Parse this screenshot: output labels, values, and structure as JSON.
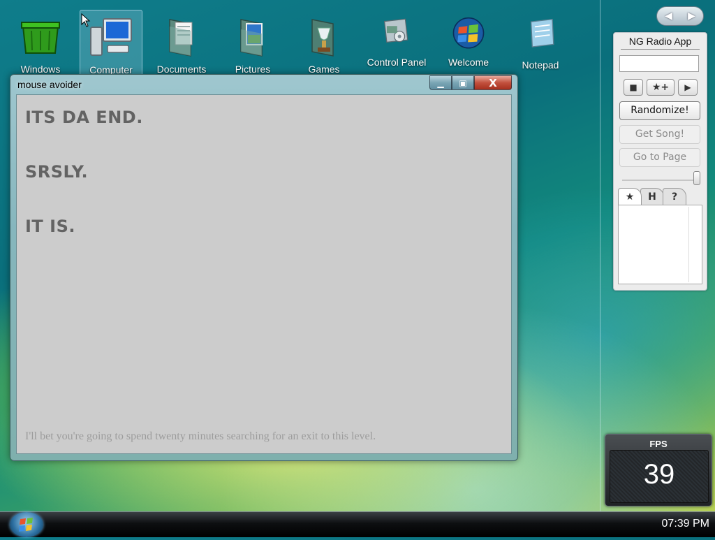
{
  "desktop": {
    "icons": [
      {
        "label": "Windows"
      },
      {
        "label": "Computer"
      },
      {
        "label": "Documents"
      },
      {
        "label": "Pictures"
      },
      {
        "label": "Games"
      },
      {
        "label": "Control Panel"
      },
      {
        "label": "Welcome"
      },
      {
        "label": "Notepad"
      }
    ]
  },
  "window": {
    "title": "mouse avoider",
    "lines": [
      "ITS DA END.",
      "SRSLY.",
      "IT IS."
    ],
    "hint": "I'll bet you're going to spend twenty minutes searching for an exit to this level.",
    "close_label": "X"
  },
  "sidebar": {
    "radio": {
      "title": "NG Radio App",
      "input_value": "",
      "stop_label": "■",
      "fav_label": "★+",
      "play_label": "▶",
      "randomize_label": "Randomize!",
      "get_song_label": "Get Song!",
      "go_to_page_label": "Go to Page",
      "tabs": [
        "★",
        "H",
        "?"
      ]
    },
    "fps": {
      "label": "FPS",
      "value": "39"
    }
  },
  "taskbar": {
    "clock": "07:39 PM"
  }
}
